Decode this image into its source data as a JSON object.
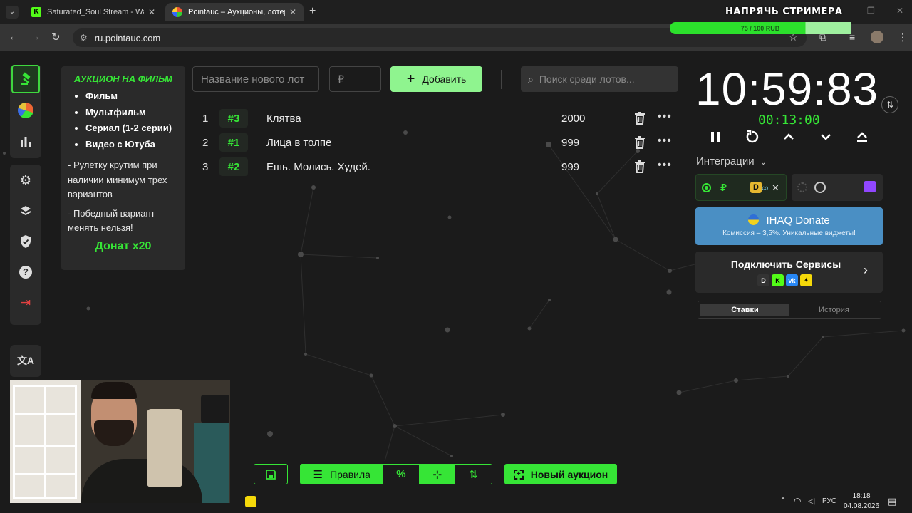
{
  "browser": {
    "tabs": [
      {
        "title": "Saturated_Soul Stream - Watch",
        "active": false
      },
      {
        "title": "Pointauc – Аукционы, лотереи",
        "active": true
      }
    ],
    "url": "ru.pointauc.com"
  },
  "overlay": {
    "goal_title": "НАПРЯЧЬ СТРИМЕРА",
    "goal_progress": "75 / 100 RUB",
    "goal_fraction": 0.75
  },
  "rules_card": {
    "title": "АУКЦИОН НА ФИЛЬМ",
    "items": [
      "Фильм",
      "Мультфильм",
      "Сериал (1-2 серии)",
      "Видео с Ютуба"
    ],
    "notes": [
      "- Рулетку крутим при наличии минимум трех вариантов",
      "- Победный вариант менять нельзя!"
    ],
    "donate": "Донат х20"
  },
  "toolbar": {
    "lot_name_placeholder": "Название нового лот",
    "amount_placeholder": "₽",
    "add_label": "Добавить",
    "search_placeholder": "Поиск среди лотов..."
  },
  "lots": [
    {
      "index": "1",
      "id": "#3",
      "name": "Клятва",
      "amount": "2000"
    },
    {
      "index": "2",
      "id": "#1",
      "name": "Лица в толпе",
      "amount": "999"
    },
    {
      "index": "3",
      "id": "#2",
      "name": "Ешь. Молись. Худей.",
      "amount": "999"
    }
  ],
  "timer": {
    "main": "10:59:83",
    "sub": "00:13:00"
  },
  "integrations": {
    "label": "Интеграции"
  },
  "ihaq": {
    "title": "IHAQ Donate",
    "subtitle": "Комиссия – 3,5%. Уникальные виджеты!"
  },
  "services": {
    "label": "Подключить Сервисы"
  },
  "history_tabs": [
    "Ставки",
    "История"
  ],
  "bottom": {
    "rules_label": "Правила",
    "percent_label": "%",
    "new_auction_label": "Новый аукцион"
  },
  "taskbar": {
    "lang": "РУС",
    "time": "18:18",
    "date": "04.08.2026"
  },
  "colors": {
    "accent": "#36e536",
    "accent_light": "#8ff48f",
    "background": "#1b1b1b",
    "panel": "#2a2a2a",
    "ihaq": "#4a8fc4"
  }
}
